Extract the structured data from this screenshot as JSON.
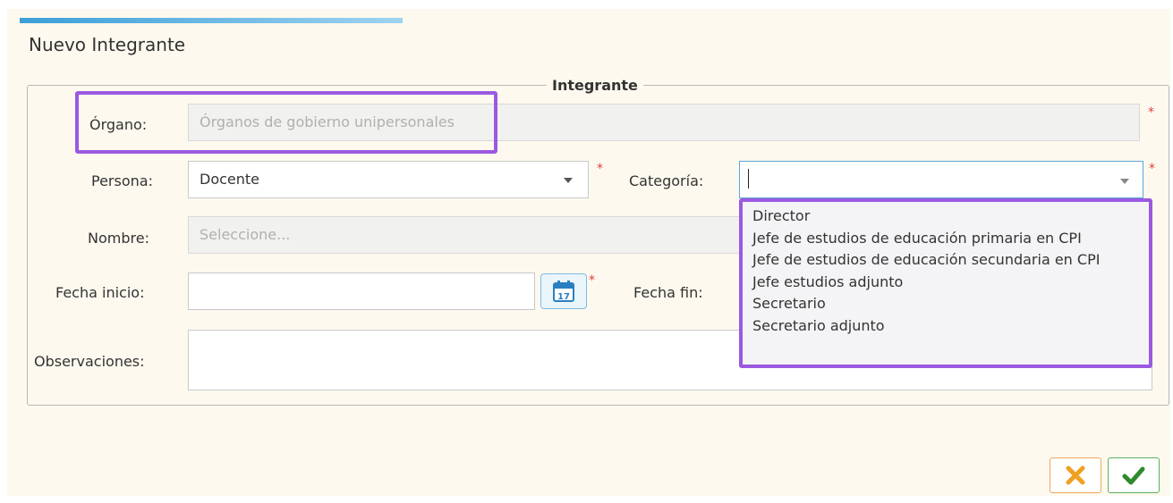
{
  "dialog": {
    "title": "Nuevo Integrante"
  },
  "fieldset": {
    "legend": "Integrante"
  },
  "organo": {
    "label": "Órgano:",
    "value": "Órganos de gobierno unipersonales",
    "required": "*"
  },
  "persona": {
    "label": "Persona:",
    "value": "Docente",
    "required": "*"
  },
  "categoria": {
    "label": "Categoría:",
    "value": "",
    "required": "*",
    "options": [
      "Director",
      "Jefe de estudios de educación primaria en CPI",
      "Jefe de estudios de educación secundaria en CPI",
      "Jefe estudios adjunto",
      "Secretario",
      "Secretario adjunto"
    ]
  },
  "nombre": {
    "label": "Nombre:",
    "placeholder": "Seleccione..."
  },
  "fecha_inicio": {
    "label": "Fecha inicio:",
    "value": "",
    "required": "*",
    "calendar_day": "17"
  },
  "fecha_fin": {
    "label": "Fecha fin:"
  },
  "observaciones": {
    "label": "Observaciones:",
    "value": ""
  },
  "icons": {
    "dropdown": "chevron-down-icon",
    "calendar": "calendar-icon",
    "cancel": "close-icon",
    "confirm": "check-icon"
  },
  "colors": {
    "highlight": "#9b59e0",
    "accent_blue": "#3b9fd8",
    "required": "#e23b3b",
    "cancel": "#f0a020",
    "confirm": "#2e8b2e"
  }
}
